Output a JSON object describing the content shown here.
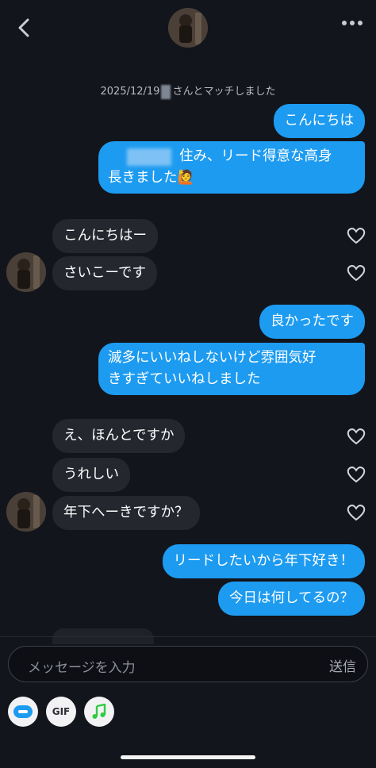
{
  "header": {
    "back_icon": "chevron-left-icon",
    "more_icon": "more-horizontal-icon"
  },
  "match_note": {
    "date": "2025/12/19",
    "text": "さんとマッチしました"
  },
  "messages": [
    {
      "side": "out",
      "text": "こんにちは"
    },
    {
      "side": "out",
      "line1": "住み、リード得意な高身",
      "line2": "長きました🙋"
    },
    {
      "side": "in",
      "text": "こんにちはー"
    },
    {
      "side": "in",
      "text": "さいこーです"
    },
    {
      "side": "out",
      "text": "良かったです"
    },
    {
      "side": "out",
      "line1": "滅多にいいねしないけど雰囲気好",
      "line2": "きすぎていいねしました"
    },
    {
      "side": "in",
      "text": "え、ほんとですか"
    },
    {
      "side": "in",
      "text": "うれしい"
    },
    {
      "side": "in",
      "text": "年下へーきですか？"
    },
    {
      "side": "out",
      "text": "リードしたいから年下好き！"
    },
    {
      "side": "out",
      "text": "今日は何してるの？"
    }
  ],
  "composer": {
    "placeholder": "メッセージを入力",
    "send_label": "送信"
  },
  "tools": {
    "gif_label": "GIF",
    "icons": [
      "sticker-icon",
      "gif-icon",
      "music-note-icon"
    ]
  },
  "colors": {
    "outgoing_bubble": "#1d9bf0",
    "incoming_bubble": "#24272e",
    "background": "#12151b",
    "music_icon": "#2ecc40"
  }
}
